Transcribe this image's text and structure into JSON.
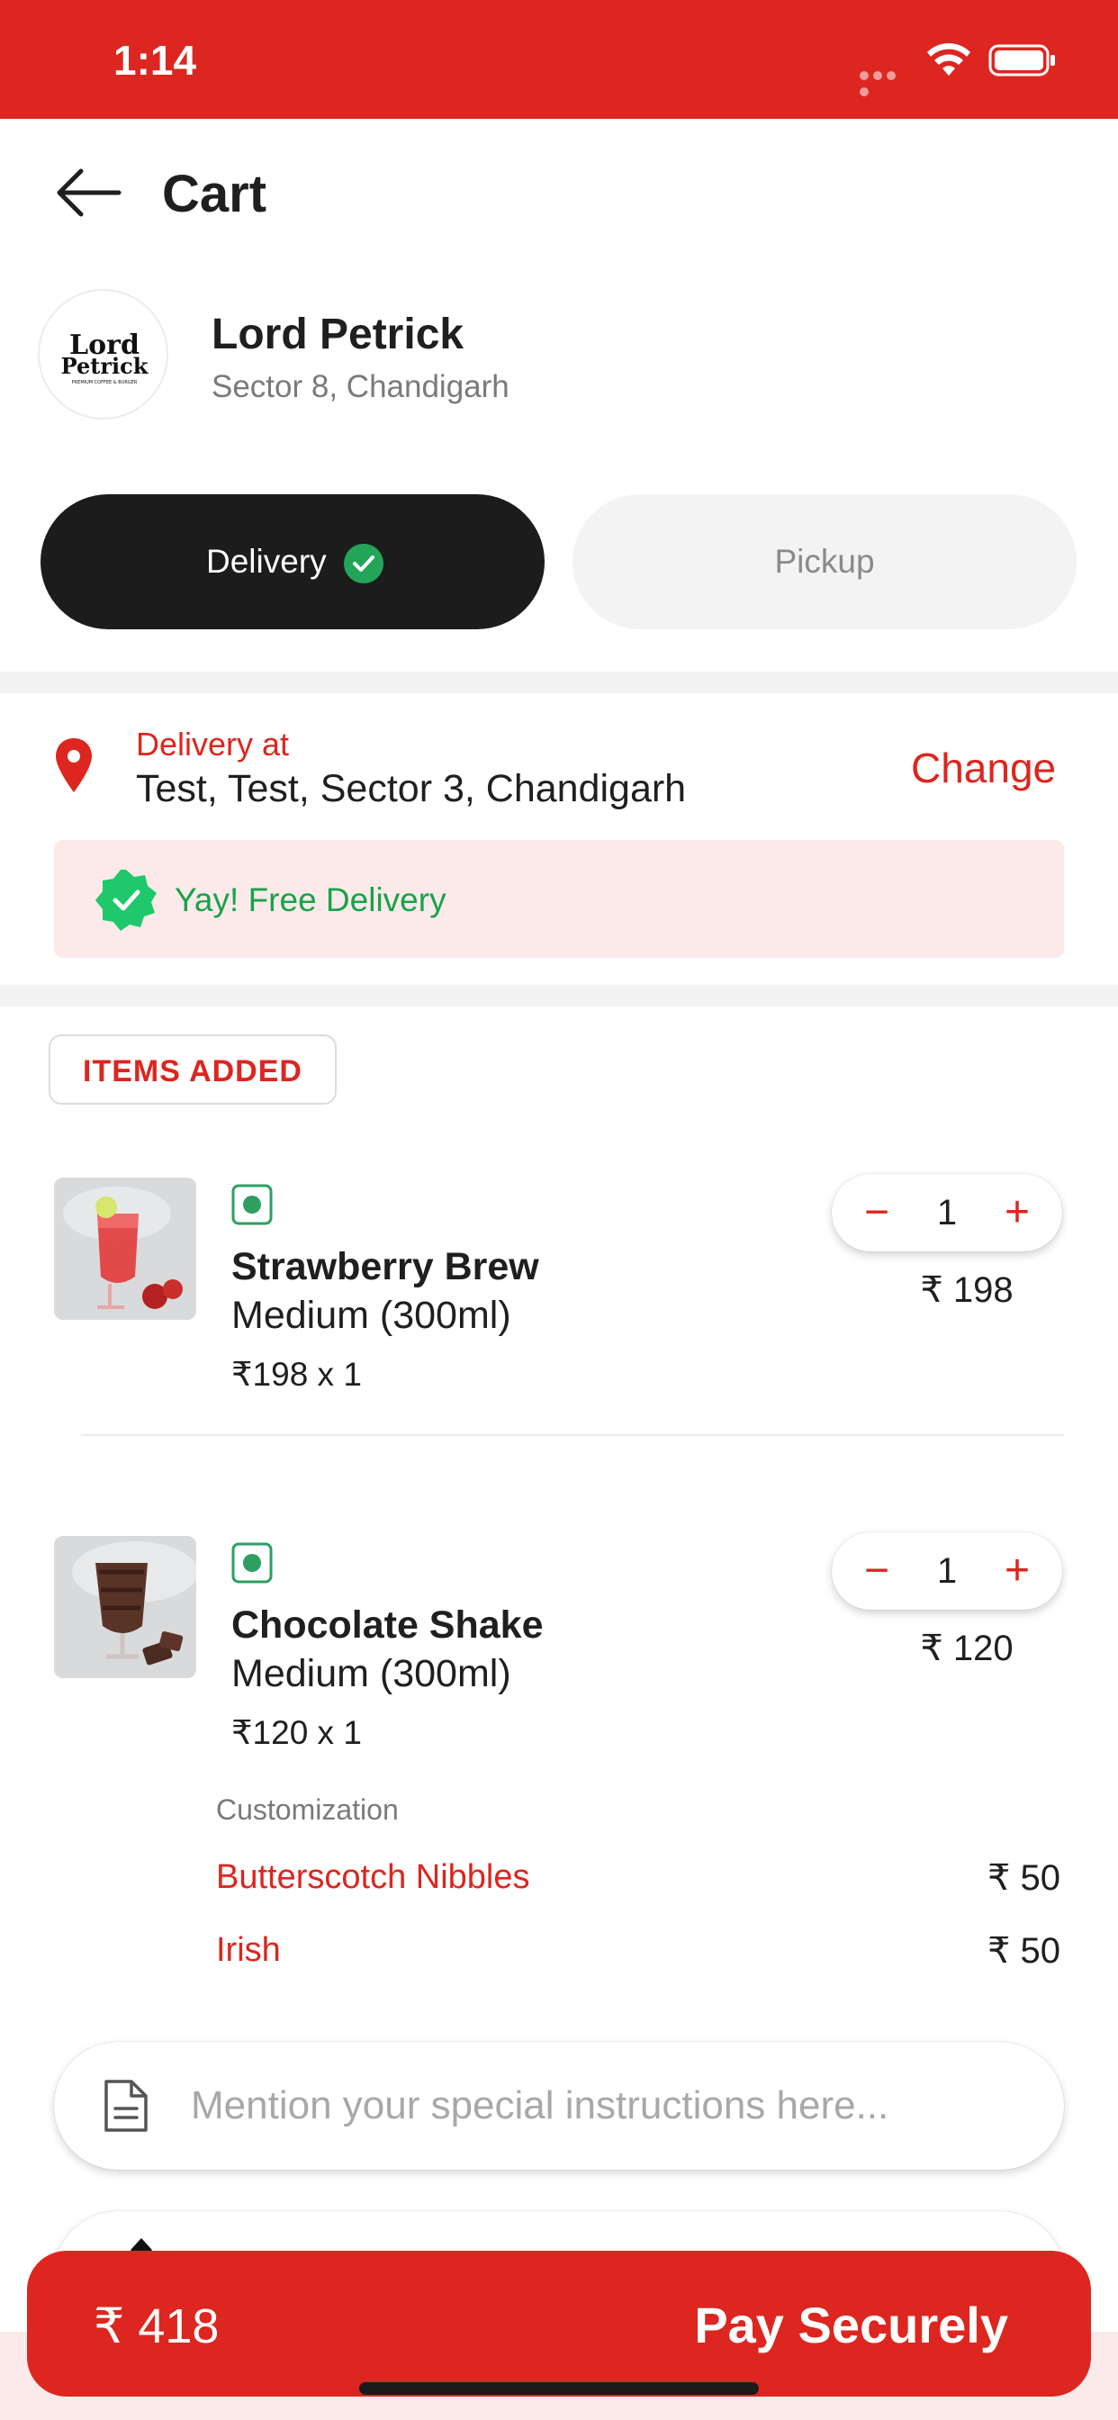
{
  "status_bar": {
    "time": "1:14"
  },
  "header": {
    "title": "Cart"
  },
  "restaurant": {
    "name": "Lord Petrick",
    "location": "Sector 8, Chandigarh",
    "logo_text_line1": "Lord",
    "logo_text_line2": "Petrick",
    "logo_tagline": "PREMIUM COFFEE & BURGER"
  },
  "mode": {
    "delivery_label": "Delivery",
    "pickup_label": "Pickup",
    "selected": "Delivery"
  },
  "delivery": {
    "heading": "Delivery at",
    "address": "Test, Test, Sector 3, Chandigarh",
    "change_label": "Change",
    "free_text": "Yay! Free Delivery"
  },
  "items_section": {
    "label": "ITEMS ADDED"
  },
  "items": [
    {
      "name": "Strawberry Brew",
      "variant": "Medium (300ml)",
      "unit_line": "₹198 x 1",
      "quantity": "1",
      "price": "₹ 198"
    },
    {
      "name": "Chocolate Shake",
      "variant": "Medium (300ml)",
      "unit_line": "₹120 x 1",
      "quantity": "1",
      "price": "₹ 120",
      "customization_label": "Customization",
      "customizations": [
        {
          "name": "Butterscotch Nibbles",
          "price": "₹ 50"
        },
        {
          "name": "Irish",
          "price": "₹ 50"
        }
      ]
    }
  ],
  "instructions": {
    "placeholder": "Mention your special instructions here..."
  },
  "pay_bar": {
    "total": "₹ 418",
    "label": "Pay Securely"
  },
  "colors": {
    "brand_red": "#dc261f",
    "success_green": "#18a34a",
    "dark_toggle": "#1c1c1c",
    "banner_pink": "#fceaea"
  }
}
